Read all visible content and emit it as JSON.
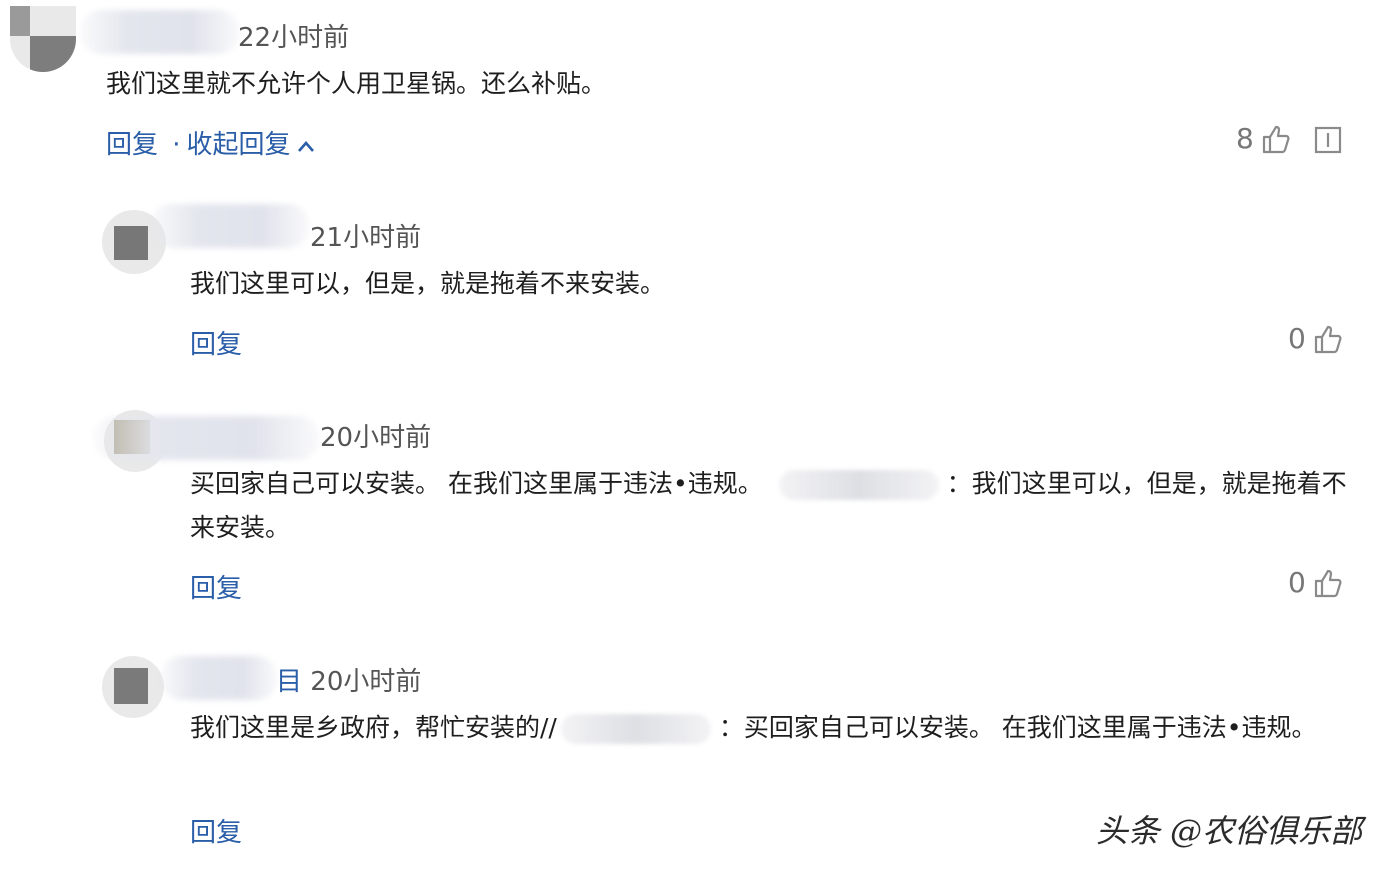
{
  "comments": [
    {
      "time": "22小时前",
      "text": "我们这里就不允许个人用卫星锅。还么补贴。",
      "reply_label": "回复",
      "separator": "·",
      "collapse_label": "收起回复",
      "likes": "8"
    },
    {
      "time": "21小时前",
      "text": "我们这里可以，但是，就是拖着不来安装。",
      "reply_label": "回复",
      "likes": "0"
    },
    {
      "time": "20小时前",
      "text_part1": "买回家自己可以安装。 在我们这里属于违法•违规。",
      "text_part2": "：我们这里可以，但是，就是拖着不来安装。",
      "reply_label": "回复",
      "likes": "0"
    },
    {
      "name_tail": "目",
      "time": "20小时前",
      "text_part1": "我们这里是乡政府，帮忙安装的//",
      "text_part2": "：买回家自己可以安装。 在我们这里属于违法•违规。",
      "reply_label": "回复"
    }
  ],
  "watermark": "头条 @农俗俱乐部",
  "icons": {
    "like": "thumbs-up-icon",
    "report": "report-icon",
    "collapse": "chevron-up-icon"
  },
  "colors": {
    "link": "#2a5ea8",
    "muted": "#777777"
  }
}
